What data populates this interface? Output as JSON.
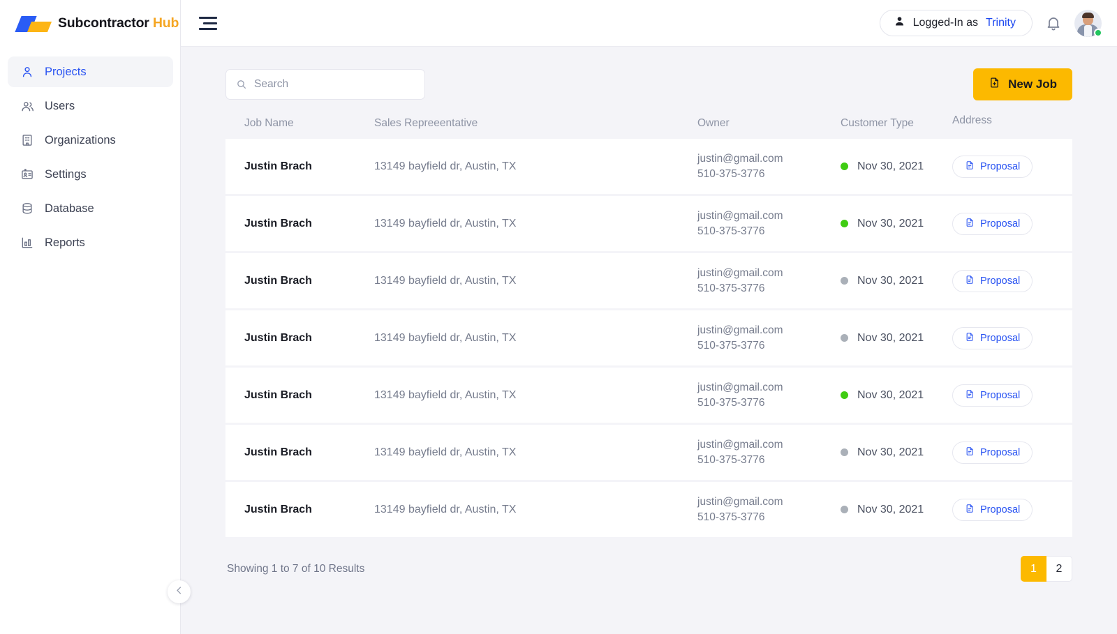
{
  "brand": {
    "name_main": "Subcontractor",
    "name_accent": "Hub"
  },
  "sidebar": {
    "items": [
      {
        "label": "Projects",
        "icon": "user-icon",
        "active": true
      },
      {
        "label": "Users",
        "icon": "users-icon",
        "active": false
      },
      {
        "label": "Organizations",
        "icon": "building-icon",
        "active": false
      },
      {
        "label": "Settings",
        "icon": "id-card-icon",
        "active": false
      },
      {
        "label": "Database",
        "icon": "database-icon",
        "active": false
      },
      {
        "label": "Reports",
        "icon": "bar-chart-icon",
        "active": false
      }
    ],
    "collapse_icon": "chevron-left-icon"
  },
  "topbar": {
    "menu_icon": "hamburger-icon",
    "login_prefix": "Logged-In as",
    "login_user": "Trinity",
    "user_icon": "person-icon",
    "bell_icon": "bell-icon",
    "avatar_status_color": "#22c55e"
  },
  "toolbar": {
    "search_placeholder": "Search",
    "search_value": "",
    "search_icon": "search-icon",
    "new_job_label": "New Job",
    "new_job_icon": "file-plus-icon",
    "new_job_color": "#fcb900"
  },
  "table": {
    "columns": [
      "Job Name",
      "Sales Repreeentative",
      "Owner",
      "Customer Type",
      "Address"
    ],
    "rows": [
      {
        "job_name": "Justin Brach",
        "sales_rep": "13149 bayfield dr, Austin, TX",
        "owner_email": "justin@gmail.com",
        "owner_phone": "510-375-3776",
        "customer_date": "Nov 30, 2021",
        "status_color": "#3fcc12",
        "action_label": "Proposal",
        "action_icon": "document-icon"
      },
      {
        "job_name": "Justin Brach",
        "sales_rep": "13149 bayfield dr, Austin, TX",
        "owner_email": "justin@gmail.com",
        "owner_phone": "510-375-3776",
        "customer_date": "Nov 30, 2021",
        "status_color": "#3fcc12",
        "action_label": "Proposal",
        "action_icon": "document-icon"
      },
      {
        "job_name": "Justin Brach",
        "sales_rep": "13149 bayfield dr, Austin, TX",
        "owner_email": "justin@gmail.com",
        "owner_phone": "510-375-3776",
        "customer_date": "Nov 30, 2021",
        "status_color": "#aab0b8",
        "action_label": "Proposal",
        "action_icon": "document-icon"
      },
      {
        "job_name": "Justin Brach",
        "sales_rep": "13149 bayfield dr, Austin, TX",
        "owner_email": "justin@gmail.com",
        "owner_phone": "510-375-3776",
        "customer_date": "Nov 30, 2021",
        "status_color": "#aab0b8",
        "action_label": "Proposal",
        "action_icon": "document-icon"
      },
      {
        "job_name": "Justin Brach",
        "sales_rep": "13149 bayfield dr, Austin, TX",
        "owner_email": "justin@gmail.com",
        "owner_phone": "510-375-3776",
        "customer_date": "Nov 30, 2021",
        "status_color": "#3fcc12",
        "action_label": "Proposal",
        "action_icon": "document-icon"
      },
      {
        "job_name": "Justin Brach",
        "sales_rep": "13149 bayfield dr, Austin, TX",
        "owner_email": "justin@gmail.com",
        "owner_phone": "510-375-3776",
        "customer_date": "Nov 30, 2021",
        "status_color": "#aab0b8",
        "action_label": "Proposal",
        "action_icon": "document-icon"
      },
      {
        "job_name": "Justin Brach",
        "sales_rep": "13149 bayfield dr, Austin, TX",
        "owner_email": "justin@gmail.com",
        "owner_phone": "510-375-3776",
        "customer_date": "Nov 30, 2021",
        "status_color": "#aab0b8",
        "action_label": "Proposal",
        "action_icon": "document-icon"
      }
    ]
  },
  "footer": {
    "showing_text": "Showing 1 to 7 of 10 Results",
    "pages": [
      {
        "label": "1",
        "active": true
      },
      {
        "label": "2",
        "active": false
      }
    ]
  }
}
